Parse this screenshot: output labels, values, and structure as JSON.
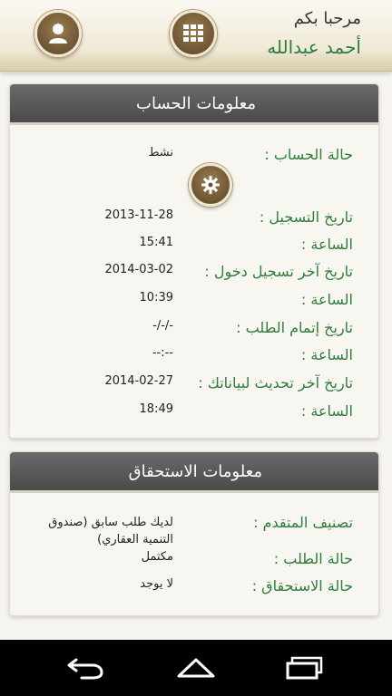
{
  "header": {
    "welcome": "مرحبا بكم",
    "user_name": "أحمد عبدالله"
  },
  "account_info": {
    "title": "معلومات الحساب",
    "rows": [
      {
        "label": "حالة الحساب :",
        "value": "نشط"
      },
      {
        "label": "تاريخ التسجيل :",
        "value": "2013-11-28"
      },
      {
        "label": "الساعة :",
        "value": "15:41"
      },
      {
        "label": "تاريخ آخر تسجيل دخول :",
        "value": "2014-03-02"
      },
      {
        "label": "الساعة :",
        "value": "10:39"
      },
      {
        "label": "تاريخ إتمام الطلب :",
        "value": "-/-/-"
      },
      {
        "label": "الساعة :",
        "value": "--:--"
      },
      {
        "label": "تاريخ آخر تحديث لبياناتك :",
        "value": "2014-02-27"
      },
      {
        "label": "الساعة :",
        "value": "18:49"
      }
    ]
  },
  "eligibility_info": {
    "title": "معلومات الاستحقاق",
    "rows": [
      {
        "label": "تصنيف المتقدم :",
        "value": "لديك طلب سابق (صندوق التنمية العقاري)"
      },
      {
        "label": "حالة الطلب :",
        "value": "مكتمل"
      },
      {
        "label": "حالة الاستحقاق :",
        "value": "لا يوجد"
      }
    ]
  },
  "icons": {
    "profile": "user-icon",
    "menu": "grid-icon",
    "settings": "gear-icon",
    "back": "back-icon",
    "home": "home-icon",
    "recents": "recents-icon"
  },
  "colors": {
    "accent_green": "#2f7d3c",
    "button_brown": "#6d5434",
    "card_header": "#555555"
  }
}
